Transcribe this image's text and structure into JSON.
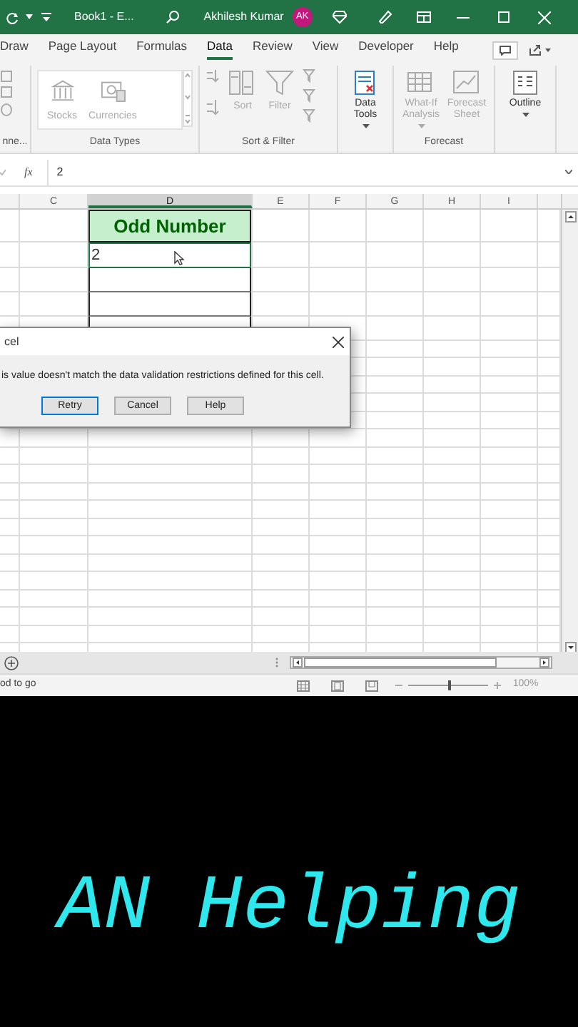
{
  "title_bar": {
    "document_title": "Book1 - E...",
    "user_name": "Akhilesh Kumar",
    "avatar_initials": "AK"
  },
  "tabs": [
    {
      "label": "Draw",
      "selected": false
    },
    {
      "label": "Page Layout",
      "selected": false
    },
    {
      "label": "Formulas",
      "selected": false
    },
    {
      "label": "Data",
      "selected": true
    },
    {
      "label": "Review",
      "selected": false
    },
    {
      "label": "View",
      "selected": false
    },
    {
      "label": "Developer",
      "selected": false
    },
    {
      "label": "Help",
      "selected": false
    }
  ],
  "ribbon_groups": [
    {
      "label": "nne...",
      "kind": "partial"
    },
    {
      "label": "Data Types",
      "kind": "gallery",
      "buttons": [
        {
          "label": "Stocks",
          "kind": "stocks",
          "disabled": true
        },
        {
          "label": "Currencies",
          "kind": "currencies",
          "disabled": true
        }
      ]
    },
    {
      "label": "Sort & Filter",
      "kind": "sort",
      "buttons": [
        {
          "label": "Sort",
          "kind": "sort",
          "disabled": true
        },
        {
          "label": "Filter",
          "kind": "filter",
          "disabled": true
        }
      ]
    },
    {
      "kind": "single",
      "buttons": [
        {
          "label": "Data Tools",
          "kind": "data-tools",
          "disabled": false,
          "has_menu": true
        }
      ]
    },
    {
      "label": "Forecast",
      "kind": "plain",
      "buttons": [
        {
          "label": "What-If Analysis",
          "kind": "what-if",
          "disabled": true,
          "has_menu": true
        },
        {
          "label": "Forecast Sheet",
          "kind": "forecast-sheet",
          "disabled": true,
          "has_menu": false
        }
      ]
    },
    {
      "kind": "single",
      "buttons": [
        {
          "label": "Outline",
          "kind": "outline",
          "disabled": false,
          "has_menu": true
        }
      ]
    }
  ],
  "formula_bar": {
    "function_label": "fx",
    "value": "2"
  },
  "sheet": {
    "columns": [
      {
        "label": "C",
        "selected": false
      },
      {
        "label": "D",
        "selected": true
      },
      {
        "label": "E",
        "selected": false
      },
      {
        "label": "F",
        "selected": false
      },
      {
        "label": "G",
        "selected": false
      },
      {
        "label": "H",
        "selected": false
      },
      {
        "label": "I",
        "selected": false
      }
    ],
    "table_header": "Odd Number",
    "active_cell_value": "2"
  },
  "dialog": {
    "title": "cel",
    "message": "is value doesn't match the data validation restrictions defined for this cell.",
    "buttons": [
      {
        "label": "Retry",
        "focused": true
      },
      {
        "label": "Cancel",
        "focused": false
      },
      {
        "label": "Help",
        "focused": false
      }
    ]
  },
  "status_bar": {
    "text": "od to go",
    "zoom": {
      "level": 0.5,
      "reading": "100%"
    }
  },
  "caption": "AN Helping"
}
